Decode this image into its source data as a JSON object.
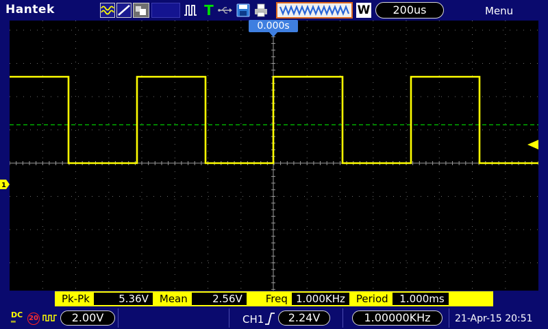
{
  "topbar": {
    "brand": "Hantek",
    "icons": [
      "waveform-mode-icon",
      "line-draw-icon",
      "persistence-icon",
      "pulse-trigger-icon",
      "trigger-t-icon",
      "usb-icon",
      "save-disk-icon",
      "printer-icon"
    ],
    "timebase_window_label": "WWWWWWWWW",
    "window_indicator": "W",
    "timebase": "200us",
    "menu_label": "Menu"
  },
  "screen": {
    "trigger_position": "0.000s",
    "channel_marker": "1",
    "waveform_color": "#ffff00",
    "trigger_level_color": "#00ff00",
    "grid_color": "#6e6e6e"
  },
  "measurements": {
    "items": [
      {
        "label": "Pk-Pk",
        "value": "5.36V"
      },
      {
        "label": "Mean",
        "value": "2.56V"
      },
      {
        "label": "Freq",
        "value": "1.000KHz"
      },
      {
        "label": "Period",
        "value": "1.000ms"
      }
    ]
  },
  "bottombar": {
    "coupling_top": "DC",
    "coupling_bottom": "═",
    "bandwidth_limit": "20",
    "volts_per_div": "2.00V",
    "trigger_source": "CH1",
    "trigger_level": "2.24V",
    "frequency_counter": "1.00000KHz",
    "datetime": "21-Apr-15 20:51"
  },
  "colors": {
    "background": "#0a0a6e",
    "accent_yellow": "#ffff00",
    "timebase_border": "#e06a20",
    "trigger_pos_blue": "#3f7fe0"
  }
}
